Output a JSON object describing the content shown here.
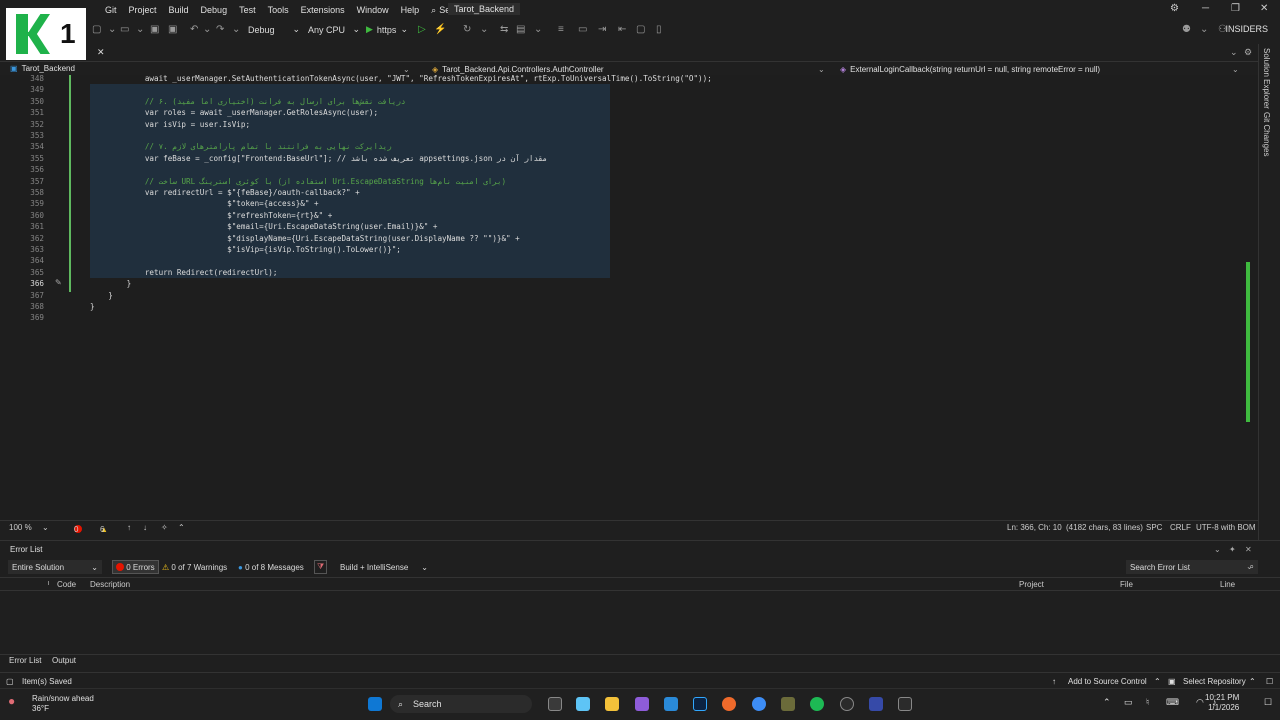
{
  "brand_badge": {
    "number": "1"
  },
  "menu": [
    "Git",
    "Project",
    "Build",
    "Debug",
    "Test",
    "Tools",
    "Extensions",
    "Window",
    "Help"
  ],
  "search_menu_label": "Search",
  "window_title": "Tarot_Backend",
  "toolbar": {
    "config": "Debug",
    "platform": "Any CPU",
    "run_target": "https",
    "insiders_label": "INSIDERS"
  },
  "tabs": {
    "file_tab": "Tarot_Backend",
    "nav_class": "Tarot_Backend.Api.Controllers.AuthController",
    "nav_member": "ExternalLoginCallback(string returnUrl = null, string remoteError = null)"
  },
  "side_panel": {
    "solution_explorer": "Solution Explorer",
    "git_changes": "Git Changes"
  },
  "editor": {
    "active_line": "366",
    "lines": [
      {
        "num": "348",
        "code": "            await _userManager.SetAuthenticationTokenAsync(user, \"JWT\", \"RefreshTokenExpiresAt\", rtExp.ToUniversalTime().ToString(\"O\"));"
      },
      {
        "num": "349",
        "code": ""
      },
      {
        "num": "350",
        "code": "            // ۶. دریافت نقش‌ها برای ارسال به فرانت (اختیاری اما مفید)"
      },
      {
        "num": "351",
        "code": "            var roles = await _userManager.GetRolesAsync(user);"
      },
      {
        "num": "352",
        "code": "            var isVip = user.IsVip;"
      },
      {
        "num": "353",
        "code": ""
      },
      {
        "num": "354",
        "code": "            // ۷. ریدایرکت نهایی به فرانتند با تمام پارامترهای لازم"
      },
      {
        "num": "355",
        "code": "            var feBase = _config[\"Frontend:BaseUrl\"]; // تعریف شده باشد appsettings.json مقدار آن در"
      },
      {
        "num": "356",
        "code": ""
      },
      {
        "num": "357",
        "code": "            // ساخت URL با کوئری استرینگ (استفاده از Uri.EscapeDataString برای امنیت نام‌ها)"
      },
      {
        "num": "358",
        "code": "            var redirectUrl = $\"{feBase}/oauth-callback?\" +"
      },
      {
        "num": "359",
        "code": "                              $\"token={access}&\" +"
      },
      {
        "num": "360",
        "code": "                              $\"refreshToken={rt}&\" +"
      },
      {
        "num": "361",
        "code": "                              $\"email={Uri.EscapeDataString(user.Email)}&\" +"
      },
      {
        "num": "362",
        "code": "                              $\"displayName={Uri.EscapeDataString(user.DisplayName ?? \"\")}&\" +"
      },
      {
        "num": "363",
        "code": "                              $\"isVip={isVip.ToString().ToLower()}\";"
      },
      {
        "num": "364",
        "code": ""
      },
      {
        "num": "365",
        "code": "            return Redirect(redirectUrl);"
      },
      {
        "num": "366",
        "code": "        }"
      },
      {
        "num": "367",
        "code": "    }"
      },
      {
        "num": "368",
        "code": "}"
      },
      {
        "num": "369",
        "code": ""
      }
    ]
  },
  "editor_status": {
    "zoom": "100 %",
    "errors": "0",
    "warnings": "6",
    "position": "Ln: 366, Ch: 10",
    "chars": "(4182 chars, 83 lines)",
    "indent": "SPC",
    "line_ending": "CRLF",
    "encoding": "UTF-8 with BOM"
  },
  "error_list": {
    "title": "Error List",
    "scope": "Entire Solution",
    "errors": "0 Errors",
    "warnings": "0 of 7 Warnings",
    "messages": "0 of 8 Messages",
    "build_filter": "Build + IntelliSense",
    "search_placeholder": "Search Error List",
    "columns": {
      "code": "Code",
      "description": "Description",
      "project": "Project",
      "file": "File",
      "line": "Line"
    }
  },
  "bottom_tabs": [
    "Error List",
    "Output"
  ],
  "status_bar": {
    "left": "Item(s) Saved",
    "source_control": "Add to Source Control",
    "repository": "Select Repository"
  },
  "taskbar": {
    "weather_title": "Rain/snow ahead",
    "weather_temp": "36°F",
    "search": "Search",
    "time": "10:21 PM",
    "date": "1/1/2026"
  }
}
